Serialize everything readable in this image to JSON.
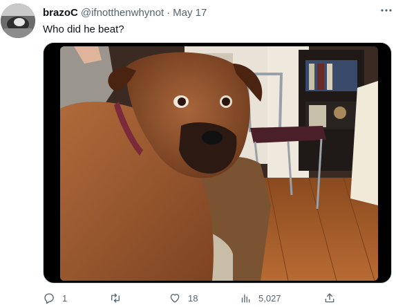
{
  "user": {
    "name": "brazoC",
    "handle": "@ifnotthenwhynot",
    "separator": "·",
    "date": "May 17"
  },
  "tweet": {
    "text": "Who did he beat?"
  },
  "actions": {
    "reply_count": "1",
    "retweet_count": "",
    "like_count": "18",
    "views_count": "5,027"
  },
  "icons": {
    "more": "more-icon",
    "reply": "reply-icon",
    "retweet": "retweet-icon",
    "like": "heart-icon",
    "views": "views-icon",
    "share": "share-icon"
  },
  "colors": {
    "text": "#0f1419",
    "secondary": "#536471",
    "media_background": "#000000"
  }
}
